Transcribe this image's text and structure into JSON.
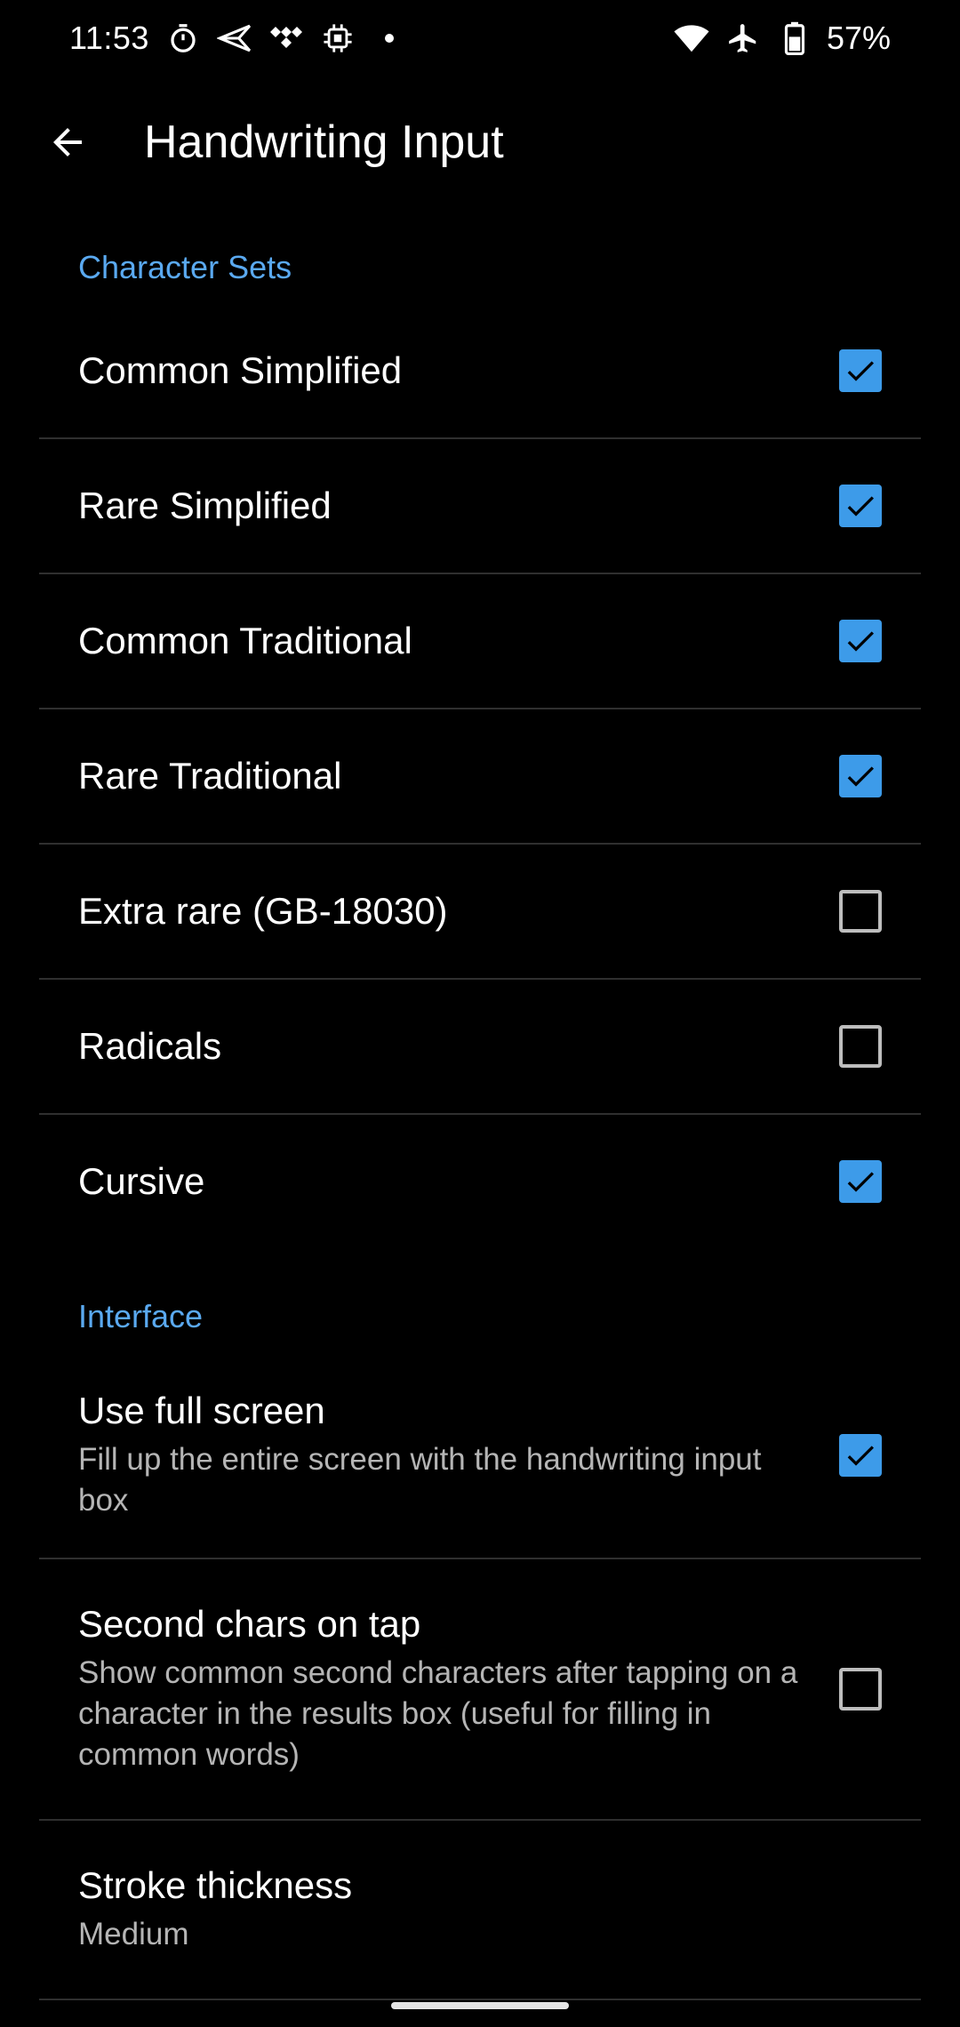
{
  "status_bar": {
    "time": "11:53",
    "left_icons": [
      "timer-icon",
      "send-icon",
      "tidal-icon",
      "chip-icon",
      "dot-icon"
    ],
    "battery_percent": "57%"
  },
  "toolbar": {
    "title": "Handwriting Input"
  },
  "sections": {
    "character_sets": {
      "title": "Character Sets",
      "items": [
        {
          "label": "Common Simplified",
          "checked": true
        },
        {
          "label": "Rare Simplified",
          "checked": true
        },
        {
          "label": "Common Traditional",
          "checked": true
        },
        {
          "label": "Rare Traditional",
          "checked": true
        },
        {
          "label": "Extra rare (GB-18030)",
          "checked": false
        },
        {
          "label": "Radicals",
          "checked": false
        },
        {
          "label": "Cursive",
          "checked": true
        }
      ]
    },
    "interface": {
      "title": "Interface",
      "use_full_screen": {
        "title": "Use full screen",
        "summary": "Fill up the entire screen with the handwriting input box",
        "checked": true
      },
      "second_chars": {
        "title": "Second chars on tap",
        "summary": "Show common second characters after tapping on a character in the results box (useful for filling in common words)",
        "checked": false
      },
      "stroke_thickness": {
        "title": "Stroke thickness",
        "value": "Medium"
      }
    }
  },
  "colors": {
    "accent": "#5aa9f0",
    "checkbox": "#3d9be9",
    "background": "#000000"
  }
}
